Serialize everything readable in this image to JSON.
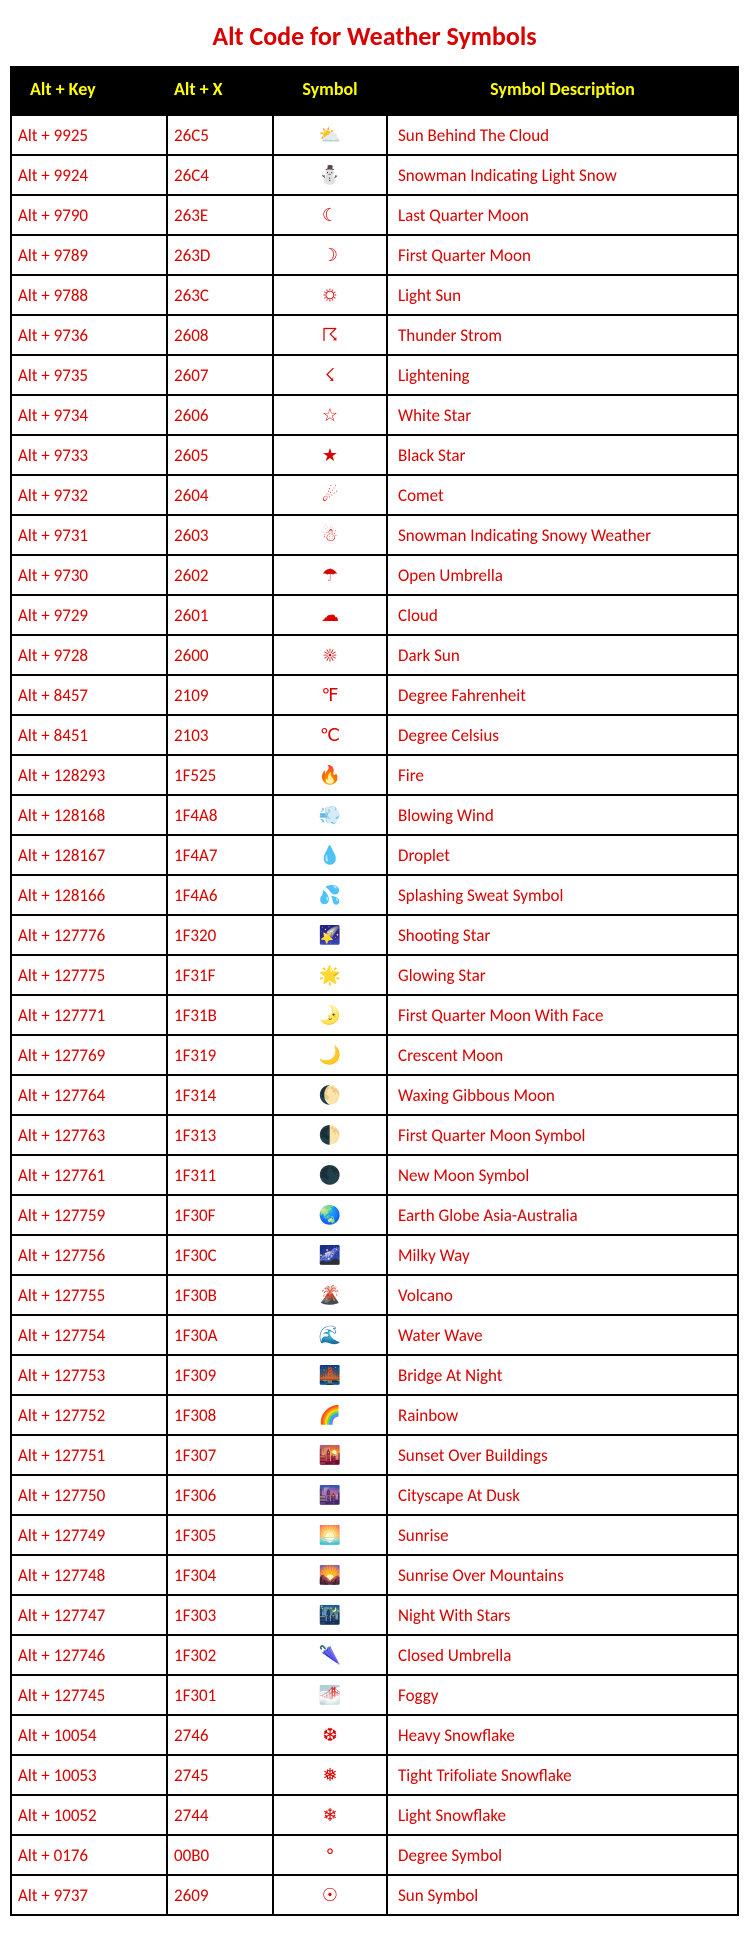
{
  "title": "Alt Code for Weather Symbols",
  "headers": {
    "alt_key": "Alt + Key",
    "alt_x": "Alt + X",
    "symbol": "Symbol",
    "desc": "Symbol Description"
  },
  "chart_data": {
    "type": "table",
    "title": "Alt Code for Weather Symbols",
    "columns": [
      "Alt + Key",
      "Alt + X",
      "Symbol",
      "Symbol Description"
    ],
    "rows": [
      {
        "alt_key": "Alt + 9925",
        "alt_x": "26C5",
        "symbol": "⛅",
        "desc": "Sun Behind The Cloud"
      },
      {
        "alt_key": "Alt + 9924",
        "alt_x": "26C4",
        "symbol": "⛄",
        "desc": "Snowman Indicating Light Snow"
      },
      {
        "alt_key": "Alt + 9790",
        "alt_x": "263E",
        "symbol": "☾",
        "desc": "Last Quarter Moon"
      },
      {
        "alt_key": "Alt + 9789",
        "alt_x": "263D",
        "symbol": "☽",
        "desc": "First Quarter Moon"
      },
      {
        "alt_key": "Alt + 9788",
        "alt_x": "263C",
        "symbol": "☼",
        "desc": "Light Sun"
      },
      {
        "alt_key": "Alt + 9736",
        "alt_x": "2608",
        "symbol": "☈",
        "desc": "Thunder Strom"
      },
      {
        "alt_key": "Alt + 9735",
        "alt_x": "2607",
        "symbol": "☇",
        "desc": "Lightening"
      },
      {
        "alt_key": "Alt + 9734",
        "alt_x": "2606",
        "symbol": "☆",
        "desc": "White Star"
      },
      {
        "alt_key": "Alt + 9733",
        "alt_x": "2605",
        "symbol": "★",
        "desc": "Black Star"
      },
      {
        "alt_key": "Alt + 9732",
        "alt_x": "2604",
        "symbol": "☄",
        "desc": "Comet"
      },
      {
        "alt_key": "Alt + 9731",
        "alt_x": "2603",
        "symbol": "☃",
        "desc": "Snowman Indicating Snowy Weather"
      },
      {
        "alt_key": "Alt + 9730",
        "alt_x": "2602",
        "symbol": "☂",
        "desc": "Open Umbrella"
      },
      {
        "alt_key": "Alt + 9729",
        "alt_x": "2601",
        "symbol": "☁",
        "desc": "Cloud"
      },
      {
        "alt_key": "Alt + 9728",
        "alt_x": "2600",
        "symbol": "☀",
        "desc": "Dark Sun"
      },
      {
        "alt_key": "Alt + 8457",
        "alt_x": "2109",
        "symbol": "℉",
        "desc": "Degree Fahrenheit"
      },
      {
        "alt_key": "Alt + 8451",
        "alt_x": "2103",
        "symbol": "℃",
        "desc": "Degree Celsius"
      },
      {
        "alt_key": "Alt + 128293",
        "alt_x": "1F525",
        "symbol": "🔥",
        "desc": "Fire"
      },
      {
        "alt_key": "Alt + 128168",
        "alt_x": "1F4A8",
        "symbol": "💨",
        "desc": "Blowing Wind"
      },
      {
        "alt_key": "Alt + 128167",
        "alt_x": "1F4A7",
        "symbol": "💧",
        "desc": "Droplet"
      },
      {
        "alt_key": "Alt + 128166",
        "alt_x": "1F4A6",
        "symbol": "💦",
        "desc": "Splashing Sweat Symbol"
      },
      {
        "alt_key": "Alt + 127776",
        "alt_x": "1F320",
        "symbol": "🌠",
        "desc": "Shooting Star"
      },
      {
        "alt_key": "Alt + 127775",
        "alt_x": "1F31F",
        "symbol": "🌟",
        "desc": "Glowing Star"
      },
      {
        "alt_key": "Alt + 127771",
        "alt_x": "1F31B",
        "symbol": "🌛",
        "desc": "First Quarter Moon With Face"
      },
      {
        "alt_key": "Alt + 127769",
        "alt_x": "1F319",
        "symbol": "🌙",
        "desc": "Crescent Moon"
      },
      {
        "alt_key": "Alt + 127764",
        "alt_x": "1F314",
        "symbol": "🌔",
        "desc": "Waxing Gibbous Moon"
      },
      {
        "alt_key": "Alt + 127763",
        "alt_x": "1F313",
        "symbol": "🌓",
        "desc": "First Quarter Moon Symbol"
      },
      {
        "alt_key": "Alt + 127761",
        "alt_x": "1F311",
        "symbol": "🌑",
        "desc": "New Moon Symbol"
      },
      {
        "alt_key": "Alt + 127759",
        "alt_x": "1F30F",
        "symbol": "🌏",
        "desc": "Earth Globe Asia-Australia"
      },
      {
        "alt_key": "Alt + 127756",
        "alt_x": "1F30C",
        "symbol": "🌌",
        "desc": "Milky Way"
      },
      {
        "alt_key": "Alt + 127755",
        "alt_x": "1F30B",
        "symbol": "🌋",
        "desc": "Volcano"
      },
      {
        "alt_key": "Alt + 127754",
        "alt_x": "1F30A",
        "symbol": "🌊",
        "desc": "Water Wave"
      },
      {
        "alt_key": "Alt + 127753",
        "alt_x": "1F309",
        "symbol": "🌉",
        "desc": "Bridge At Night"
      },
      {
        "alt_key": "Alt + 127752",
        "alt_x": "1F308",
        "symbol": "🌈",
        "desc": "Rainbow"
      },
      {
        "alt_key": "Alt + 127751",
        "alt_x": "1F307",
        "symbol": "🌇",
        "desc": "Sunset Over Buildings"
      },
      {
        "alt_key": "Alt + 127750",
        "alt_x": "1F306",
        "symbol": "🌆",
        "desc": "Cityscape At Dusk"
      },
      {
        "alt_key": "Alt + 127749",
        "alt_x": "1F305",
        "symbol": "🌅",
        "desc": "Sunrise"
      },
      {
        "alt_key": "Alt + 127748",
        "alt_x": "1F304",
        "symbol": "🌄",
        "desc": "Sunrise Over Mountains"
      },
      {
        "alt_key": "Alt + 127747",
        "alt_x": "1F303",
        "symbol": "🌃",
        "desc": "Night With Stars"
      },
      {
        "alt_key": "Alt + 127746",
        "alt_x": "1F302",
        "symbol": "🌂",
        "desc": "Closed Umbrella"
      },
      {
        "alt_key": "Alt + 127745",
        "alt_x": "1F301",
        "symbol": "🌁",
        "desc": "Foggy"
      },
      {
        "alt_key": "Alt + 10054",
        "alt_x": "2746",
        "symbol": "❆",
        "desc": "Heavy Snowflake"
      },
      {
        "alt_key": "Alt + 10053",
        "alt_x": "2745",
        "symbol": "❅",
        "desc": "Tight Trifoliate Snowflake"
      },
      {
        "alt_key": "Alt + 10052",
        "alt_x": "2744",
        "symbol": "❄",
        "desc": "Light Snowflake"
      },
      {
        "alt_key": "Alt + 0176",
        "alt_x": "00B0",
        "symbol": "°",
        "desc": "Degree Symbol"
      },
      {
        "alt_key": "Alt + 9737",
        "alt_x": "2609",
        "symbol": "☉",
        "desc": "Sun Symbol"
      }
    ]
  }
}
